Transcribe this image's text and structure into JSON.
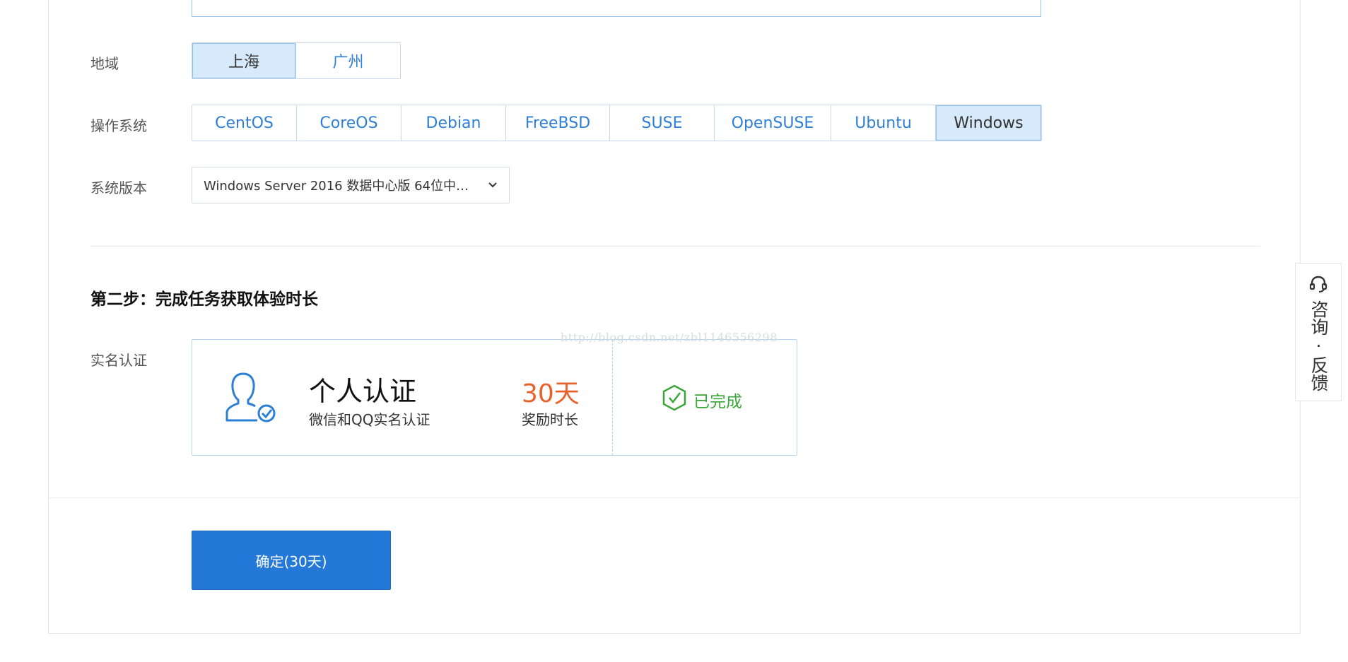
{
  "region": {
    "label": "地域",
    "options": [
      "上海",
      "广州"
    ],
    "selected": "上海"
  },
  "os": {
    "label": "操作系统",
    "options": [
      "CentOS",
      "CoreOS",
      "Debian",
      "FreeBSD",
      "SUSE",
      "OpenSUSE",
      "Ubuntu",
      "Windows"
    ],
    "selected": "Windows"
  },
  "version": {
    "label": "系统版本",
    "value": "Windows Server 2016 数据中心版 64位中…"
  },
  "step2": {
    "title": "第二步：完成任务获取体验时长",
    "task_label": "实名认证",
    "card": {
      "icon": "user-verified-icon",
      "title": "个人认证",
      "subtitle": "微信和QQ实名认证",
      "reward": "30天",
      "reward_label": "奖励时长",
      "status_icon": "check-shield-icon",
      "status": "已完成"
    }
  },
  "confirm_label": "确定(30天)",
  "watermark": "http://blog.csdn.net/zbl1146556298",
  "feedback": {
    "icon": "headset-icon",
    "label": "咨询·反馈"
  },
  "colors": {
    "accent": "#2f7fd6",
    "primary_button": "#2478d8",
    "reward": "#e8622a",
    "done": "#3aa637",
    "selected_bg": "#d7eafb"
  }
}
